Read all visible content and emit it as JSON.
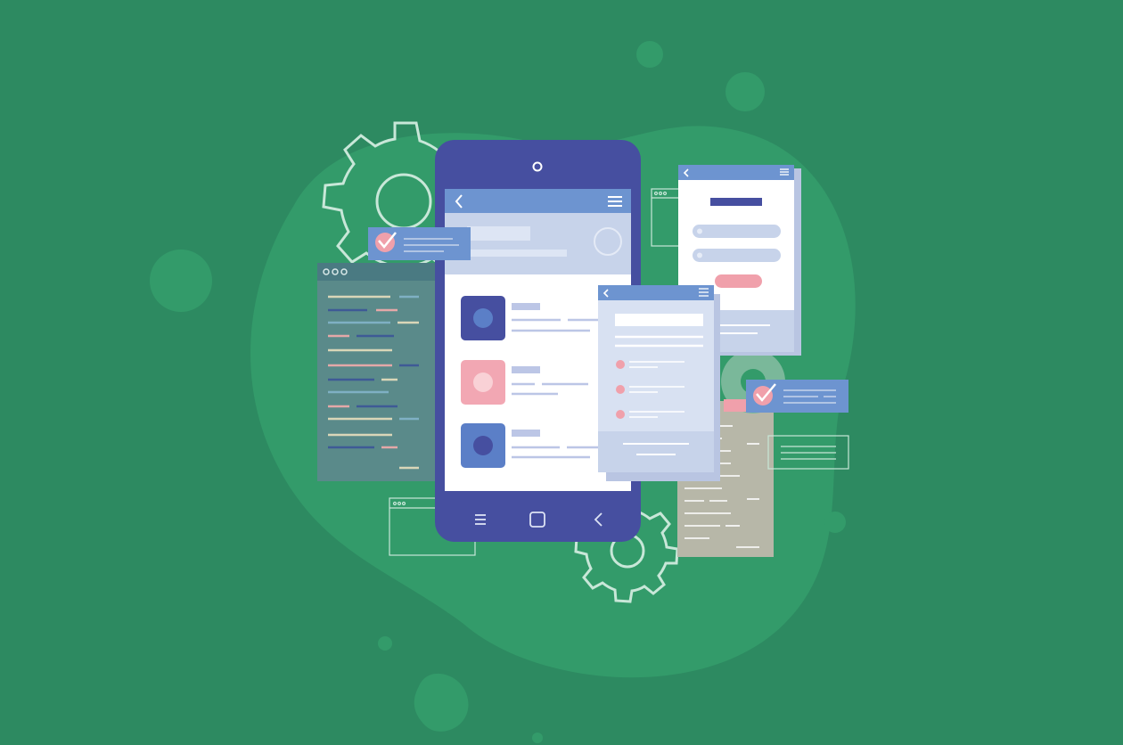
{
  "illustration": {
    "theme": "mobile app development",
    "colors": {
      "background": "#2d8a61",
      "blob": "#339b6a",
      "phone_body": "#464fa0",
      "screen": "#ffffff",
      "screen_bar": "#6d94d0",
      "screen_header": "#c7d3ea",
      "card_bg": "#d8e1f2",
      "tile_dark": "#464fa0",
      "tile_pink": "#f2a7b3",
      "tile_blue": "#5b7fc7",
      "pink_accent": "#f0a0ab",
      "gear_outline": "#c8e7d8",
      "code_panel": "#5a8a8a",
      "grey_panel": "#b7b7a8",
      "line_color": "#bcc6e6"
    },
    "icons": [
      "back-arrow-icon",
      "hamburger-menu-icon",
      "checkmark-icon",
      "gear-icon",
      "home-square-icon",
      "camera-icon"
    ]
  }
}
